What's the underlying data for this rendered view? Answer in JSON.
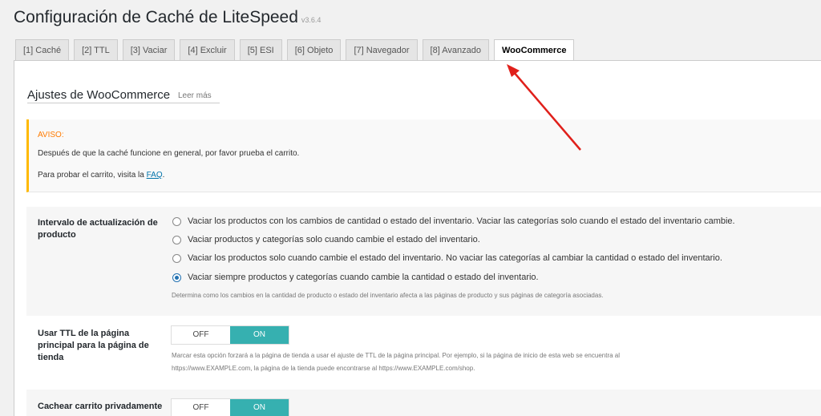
{
  "header": {
    "title": "Configuración de Caché de LiteSpeed",
    "version": "v3.6.4"
  },
  "tabs": [
    {
      "label": "[1] Caché"
    },
    {
      "label": "[2] TTL"
    },
    {
      "label": "[3] Vaciar"
    },
    {
      "label": "[4] Excluir"
    },
    {
      "label": "[5] ESI"
    },
    {
      "label": "[6] Objeto"
    },
    {
      "label": "[7] Navegador"
    },
    {
      "label": "[8] Avanzado"
    },
    {
      "label": "WooCommerce"
    }
  ],
  "section": {
    "title": "Ajustes de WooCommerce",
    "read_more": "Leer más"
  },
  "notice": {
    "title": "AVISO:",
    "line1": "Después de que la caché funcione en general, por favor prueba el carrito.",
    "line2_prefix": "Para probar el carrito, visita la ",
    "line2_link": "FAQ",
    "line2_suffix": "."
  },
  "settings": {
    "product_update": {
      "label": "Intervalo de actualización de producto",
      "options": [
        "Vaciar los productos con los cambios de cantidad o estado del inventario. Vaciar las categorías solo cuando el estado del inventario cambie.",
        "Vaciar productos y categorías solo cuando cambie el estado del inventario.",
        "Vaciar los productos solo cuando cambie el estado del inventario. No vaciar las categorías al cambiar la cantidad o estado del inventario.",
        "Vaciar siempre productos y categorías cuando cambie la cantidad o estado del inventario."
      ],
      "selected_index": 3,
      "description": "Determina como los cambios en la cantidad de producto o estado del inventario afecta a las páginas de producto y sus páginas de categoría asociadas."
    },
    "front_ttl": {
      "label": "Usar TTL de la página principal para la página de tienda",
      "off": "OFF",
      "on": "ON",
      "value": "ON",
      "description_line1": "Marcar esta opción forzará a la página de tienda a usar el ajuste de TTL de la página principal. Por ejemplo, si la página de inicio de esta web se encuentra al",
      "description_line2": "https://www.EXAMPLE.com, la página de la tienda puede encontrarse al https://www.EXAMPLE.com/shop."
    },
    "private_cart": {
      "label": "Cachear carrito privadamente",
      "off": "OFF",
      "on": "ON",
      "value": "ON"
    }
  },
  "annotation": {
    "color": "#e0201b"
  }
}
